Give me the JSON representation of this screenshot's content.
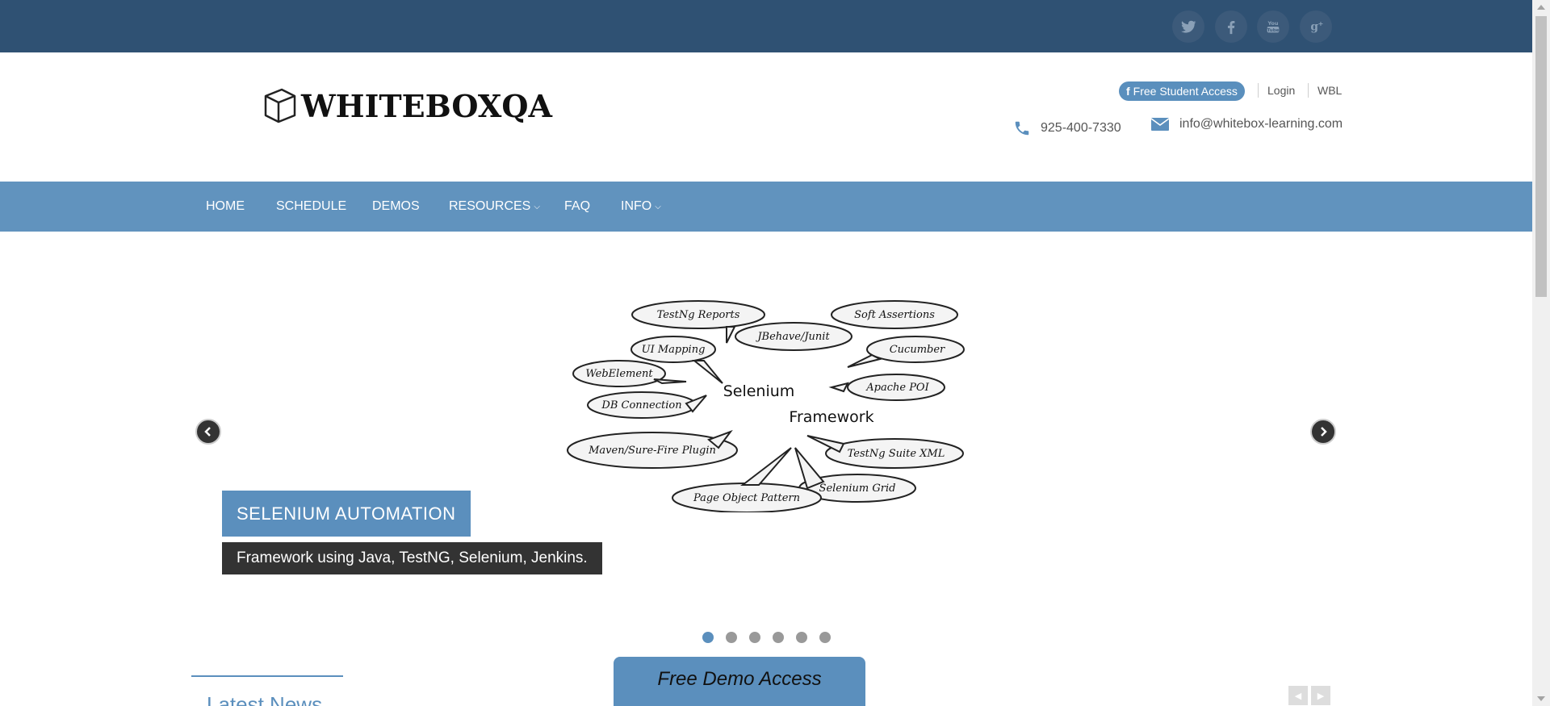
{
  "social": [
    {
      "name": "twitter",
      "glyph": "t"
    },
    {
      "name": "facebook",
      "glyph": "f"
    },
    {
      "name": "youtube",
      "glyph": "You Tube"
    },
    {
      "name": "google-plus",
      "glyph": "g+"
    }
  ],
  "logo": {
    "text": "WHITEBOXQA"
  },
  "header": {
    "student_access": "Free Student Access",
    "login": "Login",
    "wbl": "WBL",
    "phone": "925-400-7330",
    "email": "info@whitebox-learning.com"
  },
  "nav": {
    "items": [
      {
        "label": "HOME",
        "dropdown": false
      },
      {
        "label": "SCHEDULE",
        "dropdown": false
      },
      {
        "label": "DEMOS",
        "dropdown": false
      },
      {
        "label": "RESOURCES",
        "dropdown": true
      },
      {
        "label": "FAQ",
        "dropdown": false
      },
      {
        "label": "INFO",
        "dropdown": true
      }
    ]
  },
  "slider": {
    "caption_title": "SELENIUM AUTOMATION",
    "caption_subtitle": "Framework using Java, TestNG, Selenium, Jenkins.",
    "diagram": {
      "center_1": "Selenium",
      "center_2": "Framework",
      "bubbles": [
        "TestNg Reports",
        "Soft Assertions",
        "JBehave/Junit",
        "UI Mapping",
        "Cucumber",
        "WebElement",
        "Apache POI",
        "DB Connection",
        "Maven/Sure-Fire Plugin",
        "TestNg Suite XML",
        "Selenium Grid",
        "Page Object Pattern"
      ]
    },
    "dots": 6,
    "active_dot": 0
  },
  "bottom": {
    "news_title": "Latest News",
    "demo_button": "Free Demo Access"
  },
  "colors": {
    "topbar": "#2f5173",
    "accent": "#5b8fbd",
    "nav": "#6193be"
  }
}
